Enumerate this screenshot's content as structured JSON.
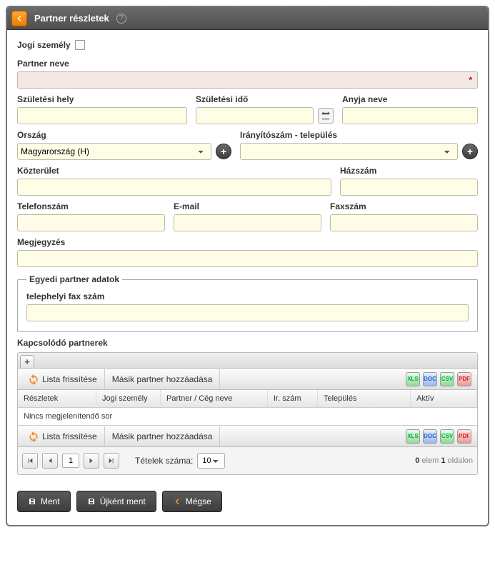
{
  "title": "Partner részletek",
  "legal_entity_label": "Jogi személy",
  "partner_name_label": "Partner neve",
  "partner_name_value": "",
  "birth_place_label": "Születési hely",
  "birth_place_value": "",
  "birth_time_label": "Születési idő",
  "birth_time_value": "",
  "mother_name_label": "Anyja neve",
  "mother_name_value": "",
  "country_label": "Ország",
  "country_value": "Magyarország (H)",
  "zip_city_label": "Irányítószám - település",
  "zip_city_value": "",
  "street_label": "Közterület",
  "street_value": "",
  "house_no_label": "Házszám",
  "house_no_value": "",
  "phone_label": "Telefonszám",
  "phone_value": "",
  "email_label": "E-mail",
  "email_value": "",
  "fax_label": "Faxszám",
  "fax_value": "",
  "note_label": "Megjegyzés",
  "note_value": "",
  "custom_legend": "Egyedi partner adatok",
  "custom_fax_label": "telephelyi fax szám",
  "custom_fax_value": "",
  "related_label": "Kapcsolódó partnerek",
  "toolbar": {
    "refresh_label": "Lista frissítése",
    "add_partner_label": "Másik partner hozzáadása"
  },
  "grid": {
    "col_details": "Részletek",
    "col_legal": "Jogi személy",
    "col_name": "Partner / Cég neve",
    "col_zip": "Ir. szám",
    "col_city": "Település",
    "col_active": "Aktív",
    "empty_text": "Nincs megjelenítendő sor"
  },
  "pager": {
    "page_value": "1",
    "items_label": "Tételek száma:",
    "page_size": "10",
    "zero": "0",
    "elem": "elem",
    "one": "1",
    "oldalon": "oldalon"
  },
  "export_icons": {
    "xls": "XLS",
    "doc": "DOC",
    "csv": "CSV",
    "pdf": "PDF"
  },
  "actions": {
    "save": "Ment",
    "save_as_new": "Újként ment",
    "cancel": "Mégse"
  }
}
